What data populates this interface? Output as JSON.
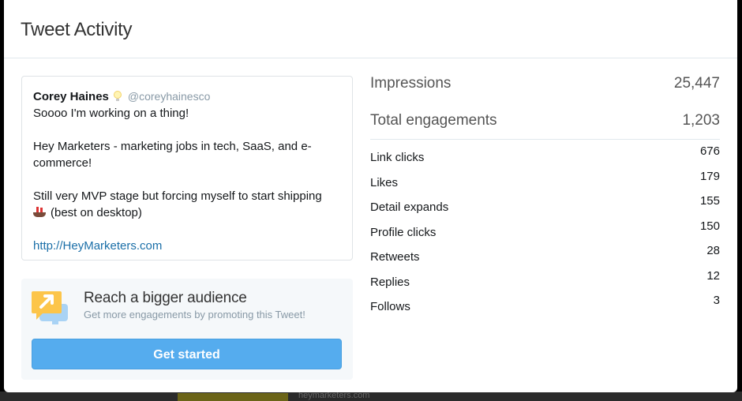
{
  "modal": {
    "title": "Tweet Activity"
  },
  "tweet": {
    "author_name": "Corey Haines",
    "author_handle": "@coreyhainesco",
    "line1": "Soooo I'm working on a thing!",
    "line2": "Hey Marketers - marketing jobs in tech, SaaS, and e-commerce!",
    "line3_part1": "Still very MVP stage but forcing myself to start shipping",
    "line3_part2": "(best on desktop)",
    "link": "http://HeyMarketers.com"
  },
  "promo": {
    "title": "Reach a bigger audience",
    "subtitle": "Get more engagements by promoting this Tweet!",
    "button_label": "Get started"
  },
  "stats": {
    "impressions": {
      "label": "Impressions",
      "value": "25,447"
    },
    "engagements": {
      "label": "Total engagements",
      "value": "1,203"
    },
    "breakdown": [
      {
        "label": "Link clicks",
        "value": "676"
      },
      {
        "label": "Likes",
        "value": "179"
      },
      {
        "label": "Detail expands",
        "value": "155"
      },
      {
        "label": "Profile clicks",
        "value": "150"
      },
      {
        "label": "Retweets",
        "value": "28"
      },
      {
        "label": "Replies",
        "value": "12"
      },
      {
        "label": "Follows",
        "value": "3"
      }
    ]
  },
  "background": {
    "faint_text": "heymarketers.com"
  },
  "colors": {
    "accent": "#55acee",
    "link": "#1b6fa8",
    "promo_bg": "#f5f8fa",
    "promo_icon_yellow": "#fcc54a",
    "promo_icon_blue": "#a9d3f5"
  }
}
